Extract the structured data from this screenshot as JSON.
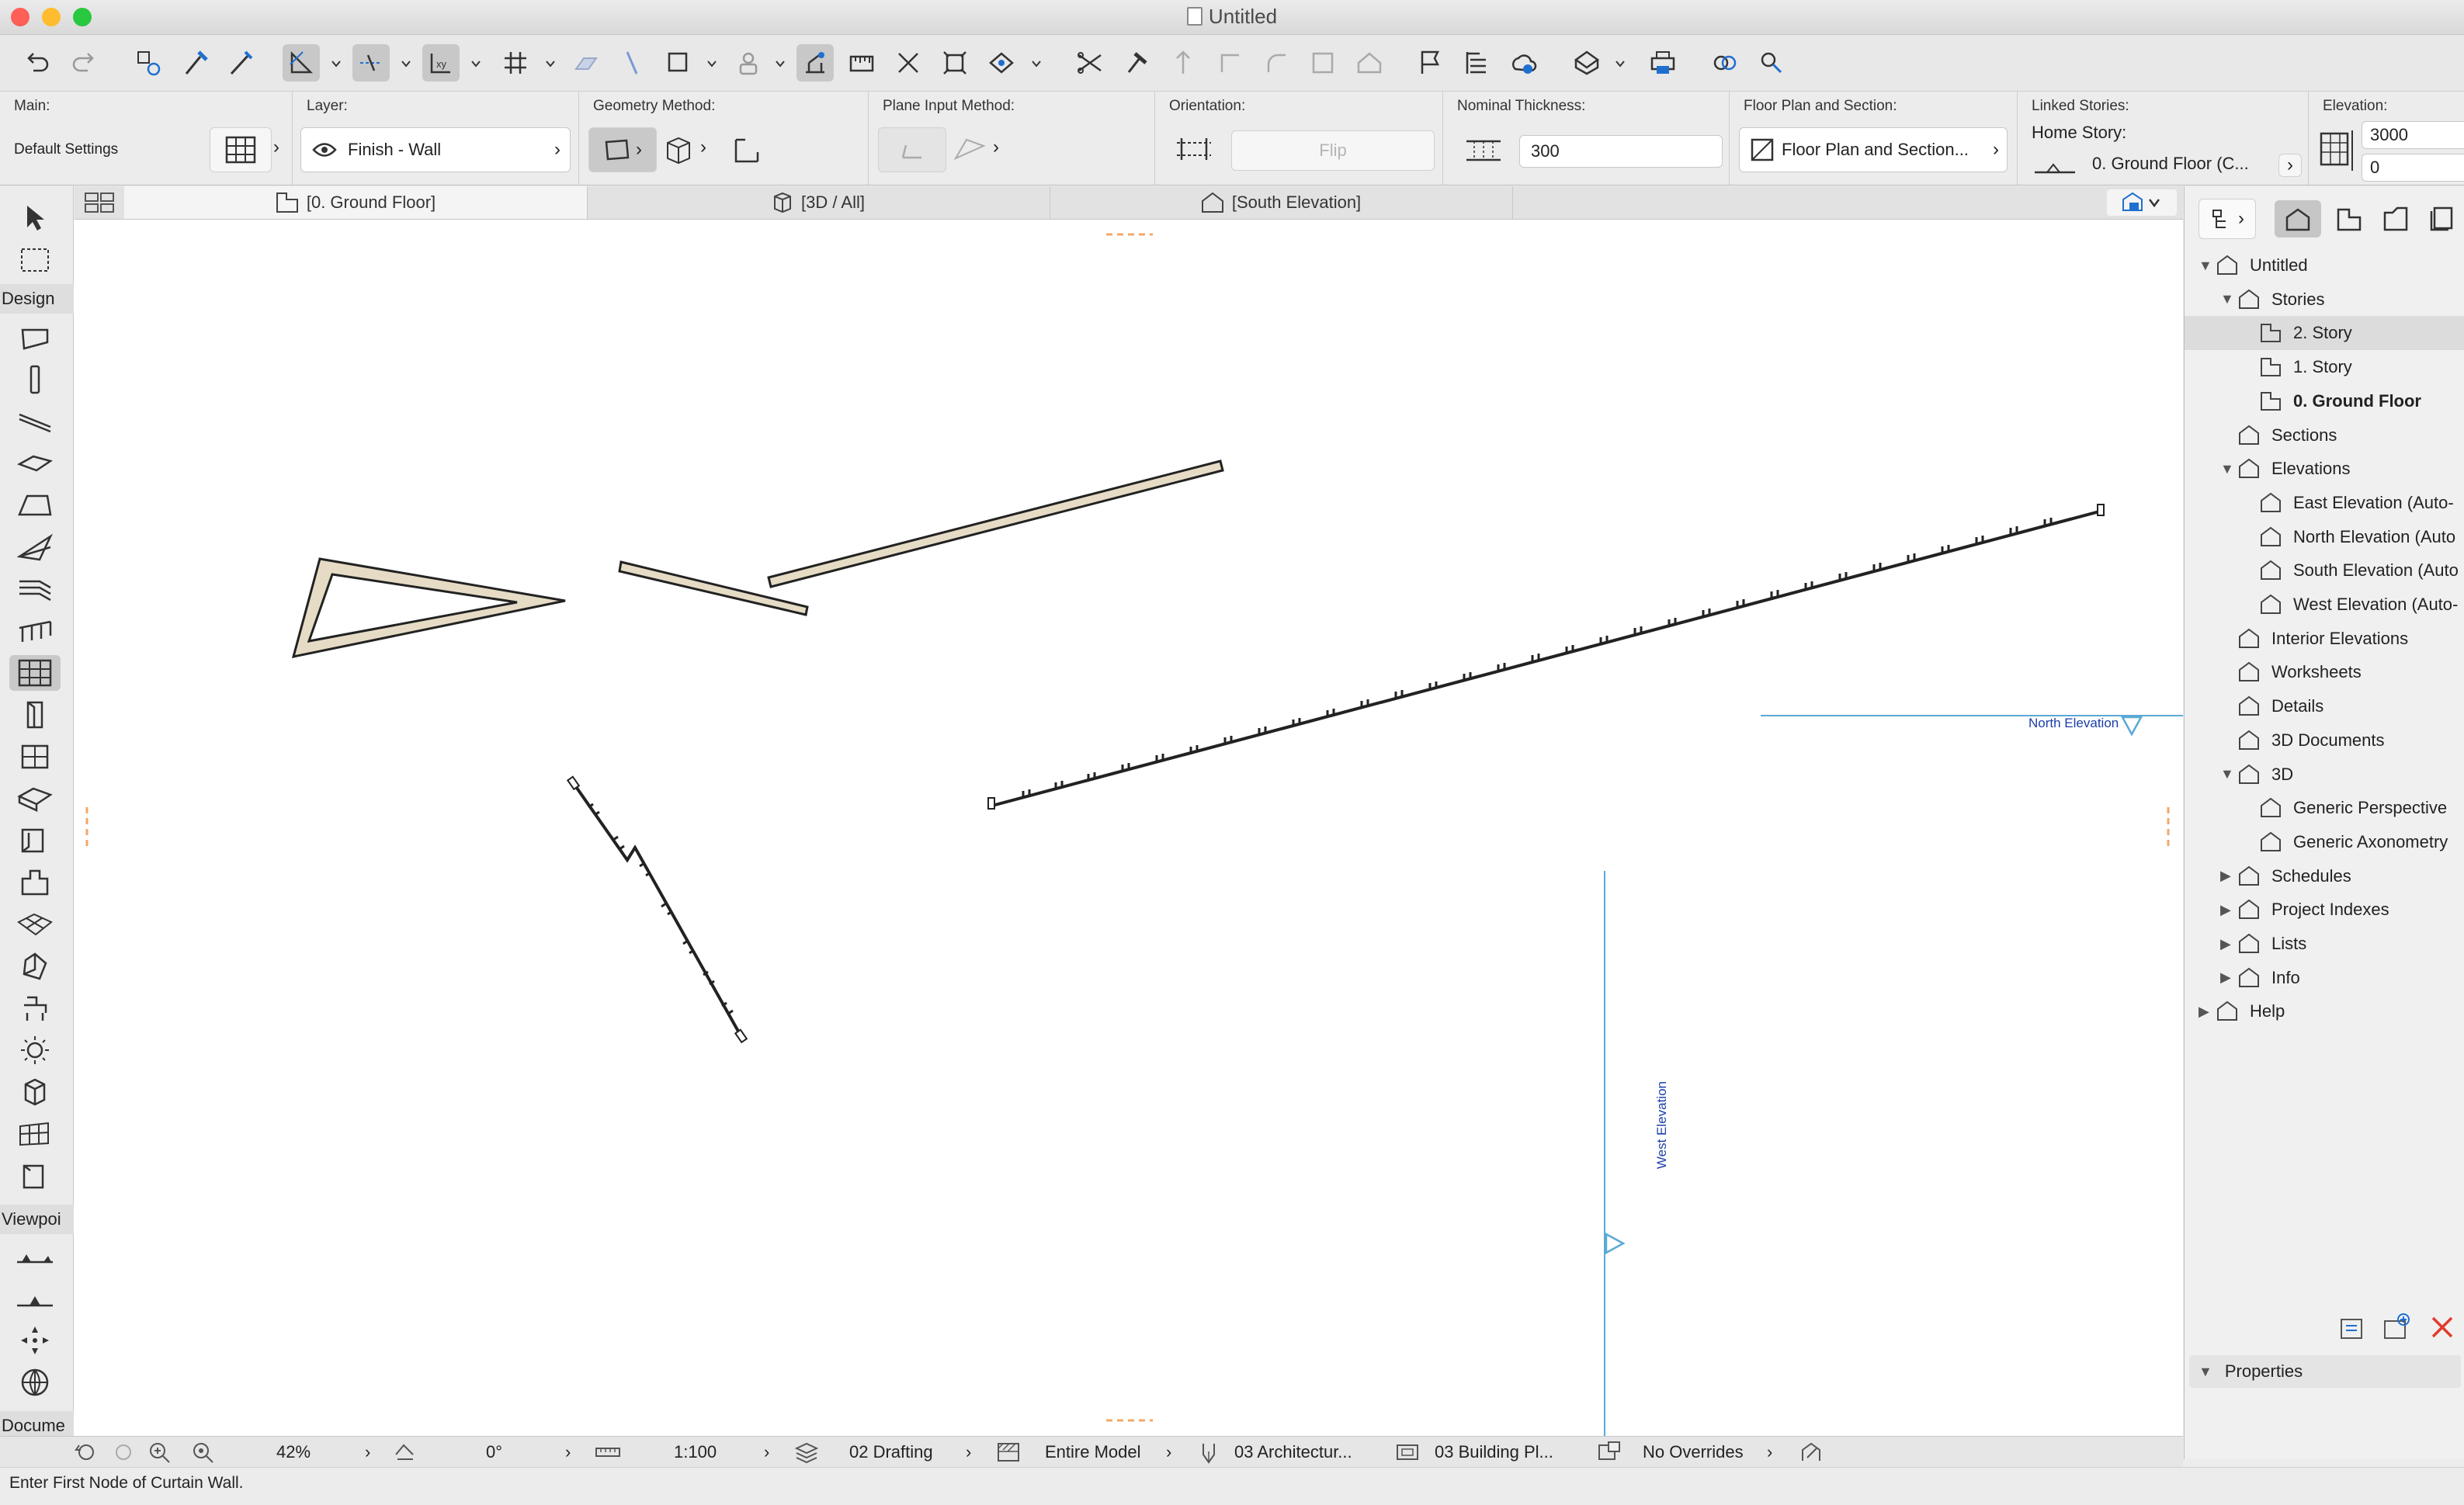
{
  "window": {
    "title": "Untitled"
  },
  "colors": {
    "close": "#fe5f57",
    "minimize": "#febc2e",
    "zoom": "#28c840",
    "wall_fill": "#e6dcc6",
    "elevation_marker": "#5aa9d6",
    "elevation_text": "#1a3ea8",
    "delete": "#e03b2b"
  },
  "toolbar": {
    "icons": [
      "undo-icon",
      "redo-icon",
      "magic-wand-icon",
      "pick-up-icon",
      "inject-icon",
      "snap-guides-icon",
      "guide-lines-icon",
      "gravity-icon",
      "grid-snap-icon",
      "trace-icon",
      "parallel-icon",
      "perpendicular-icon",
      "rectangle-icon",
      "user-icon",
      "magnet-icon",
      "measure-icon",
      "dimension-icon",
      "fit-icon",
      "zoom-extent-icon",
      "drag-icon",
      "cut-icon",
      "hammer-icon",
      "align-icon",
      "offset-icon",
      "fillet-icon",
      "layer-icon",
      "roof-icon",
      "flag-icon",
      "list-icon",
      "cloud-icon",
      "viewpoint-icon",
      "printer-icon",
      "link-icon",
      "sync-icon"
    ]
  },
  "infobox": {
    "main": {
      "label": "Main:",
      "value": "Default Settings"
    },
    "layer": {
      "label": "Layer:",
      "value": "Finish - Wall"
    },
    "geometry": {
      "label": "Geometry Method:"
    },
    "plane_input": {
      "label": "Plane Input Method:"
    },
    "orientation": {
      "label": "Orientation:",
      "flip": "Flip"
    },
    "thickness": {
      "label": "Nominal Thickness:",
      "value": "300"
    },
    "floorplan": {
      "label": "Floor Plan and Section:",
      "value": "Floor Plan and Section..."
    },
    "linked": {
      "label": "Linked Stories:",
      "home_label": "Home Story:",
      "home_value": "0. Ground Floor (C..."
    },
    "elevation": {
      "label": "Elevation:",
      "top": "3000",
      "bottom": "0"
    }
  },
  "tabs": [
    {
      "label": "[0. Ground Floor]",
      "icon": "floor-plan-icon"
    },
    {
      "label": "[3D / All]",
      "icon": "cube-icon"
    },
    {
      "label": "[South Elevation]",
      "icon": "elevation-icon"
    }
  ],
  "toolbox": {
    "group_design": "Design",
    "group_viewpoint": "Viewpoi",
    "group_document": "Docume"
  },
  "canvas": {
    "north_elevation": "North Elevation",
    "west_elevation": "West Elevation"
  },
  "navigator": {
    "items": [
      {
        "label": "Untitled",
        "depth": 0,
        "tri": "▼"
      },
      {
        "label": "Stories",
        "depth": 1,
        "tri": "▼"
      },
      {
        "label": "2. Story",
        "depth": 2,
        "tri": "",
        "selected": true
      },
      {
        "label": "1. Story",
        "depth": 2,
        "tri": ""
      },
      {
        "label": "0. Ground Floor",
        "depth": 2,
        "tri": "",
        "bold": true
      },
      {
        "label": "Sections",
        "depth": 1,
        "tri": ""
      },
      {
        "label": "Elevations",
        "depth": 1,
        "tri": "▼"
      },
      {
        "label": "East Elevation (Auto-",
        "depth": 2,
        "tri": ""
      },
      {
        "label": "North Elevation (Auto",
        "depth": 2,
        "tri": ""
      },
      {
        "label": "South Elevation (Auto",
        "depth": 2,
        "tri": ""
      },
      {
        "label": "West Elevation (Auto-",
        "depth": 2,
        "tri": ""
      },
      {
        "label": "Interior Elevations",
        "depth": 1,
        "tri": ""
      },
      {
        "label": "Worksheets",
        "depth": 1,
        "tri": ""
      },
      {
        "label": "Details",
        "depth": 1,
        "tri": ""
      },
      {
        "label": "3D Documents",
        "depth": 1,
        "tri": ""
      },
      {
        "label": "3D",
        "depth": 1,
        "tri": "▼"
      },
      {
        "label": "Generic Perspective",
        "depth": 2,
        "tri": ""
      },
      {
        "label": "Generic Axonometry",
        "depth": 2,
        "tri": ""
      },
      {
        "label": "Schedules",
        "depth": 1,
        "tri": "▶"
      },
      {
        "label": "Project Indexes",
        "depth": 1,
        "tri": "▶"
      },
      {
        "label": "Lists",
        "depth": 1,
        "tri": "▶"
      },
      {
        "label": "Info",
        "depth": 1,
        "tri": "▶"
      },
      {
        "label": "Help",
        "depth": 0,
        "tri": "▶"
      }
    ],
    "properties": "Properties"
  },
  "quick_options": {
    "zoom": "42%",
    "angle": "0°",
    "scale": "1:100",
    "layer_combo": "02 Drafting",
    "model_view": "Entire Model",
    "pen_set": "03 Architectur...",
    "model_view_option": "03 Building Pl...",
    "overrides": "No Overrides"
  },
  "status": {
    "message": "Enter First Node of Curtain Wall."
  }
}
